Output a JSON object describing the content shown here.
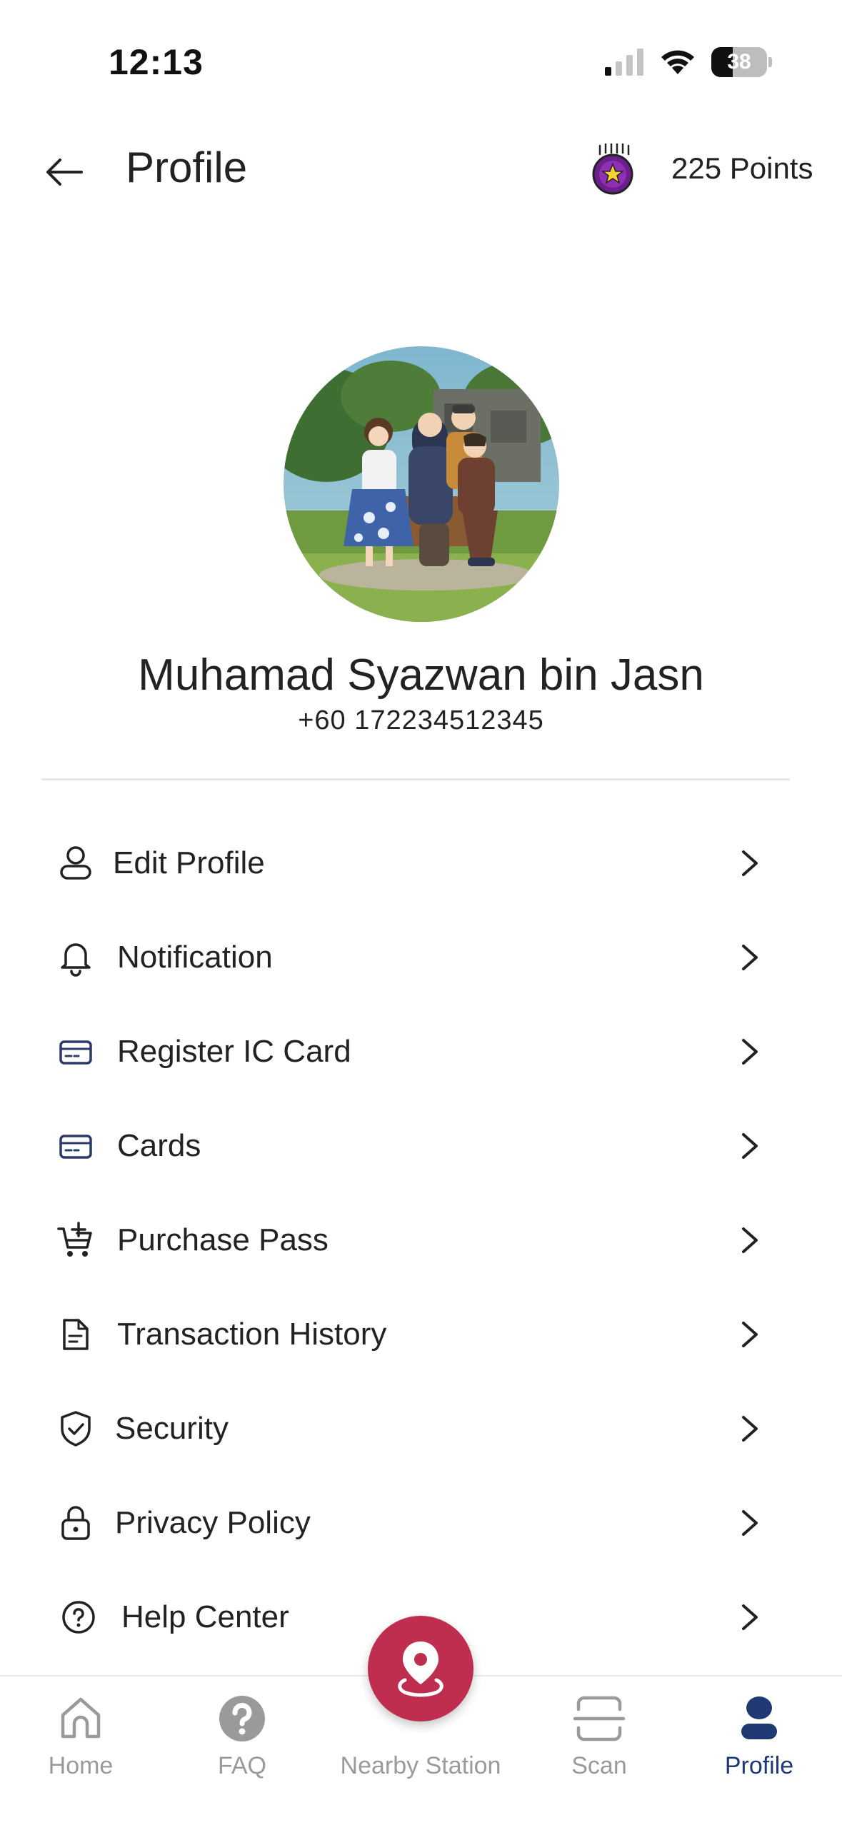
{
  "status_bar": {
    "time": "12:13",
    "battery_percent": "38",
    "battery_level": 0.38
  },
  "header": {
    "title": "Profile",
    "points_label": "225 Points",
    "points_icon": "star-medal-icon",
    "back_icon": "arrow-left-icon"
  },
  "profile": {
    "name": "Muhamad Syazwan bin Jasn",
    "phone": "+60 172234512345"
  },
  "menu": {
    "items": [
      {
        "label": "Edit Profile",
        "icon": "user-icon"
      },
      {
        "label": "Notification",
        "icon": "bell-icon"
      },
      {
        "label": "Register IC Card",
        "icon": "card-icon"
      },
      {
        "label": "Cards",
        "icon": "card-icon"
      },
      {
        "label": "Purchase Pass",
        "icon": "cart-add-icon"
      },
      {
        "label": "Transaction History",
        "icon": "document-icon"
      },
      {
        "label": "Security",
        "icon": "shield-check-icon"
      },
      {
        "label": "Privacy Policy",
        "icon": "lock-icon"
      },
      {
        "label": "Help Center",
        "icon": "help-circle-icon"
      }
    ]
  },
  "bottom_nav": {
    "items": [
      {
        "label": "Home",
        "icon": "home-icon",
        "active": false
      },
      {
        "label": "FAQ",
        "icon": "question-icon",
        "active": false
      },
      {
        "label": "Nearby Station",
        "icon": "map-pin-icon",
        "active": false
      },
      {
        "label": "Scan",
        "icon": "scan-icon",
        "active": false
      },
      {
        "label": "Profile",
        "icon": "person-icon",
        "active": true
      }
    ]
  },
  "colors": {
    "accent": "#bf2e4f",
    "active_nav": "#1f3a73",
    "inactive_nav": "#9a9a9a",
    "card_icon": "#2b3a6b"
  }
}
